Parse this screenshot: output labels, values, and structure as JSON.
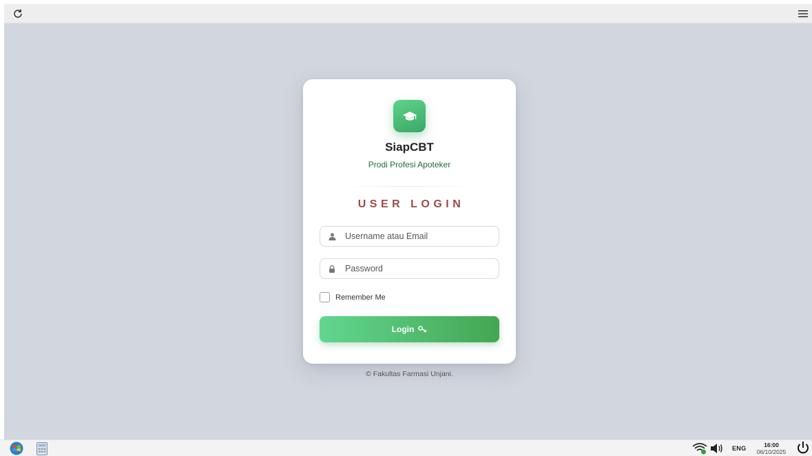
{
  "topbar": {
    "refresh_icon": "refresh-icon",
    "menu_icon": "hamburger-menu-icon"
  },
  "login_card": {
    "logo_icon": "graduation-cap-icon",
    "app_name": "SiapCBT",
    "subtitle": "Prodi Profesi Apoteker",
    "heading": "USER LOGIN",
    "username_placeholder": "Username atau Email",
    "username_value": "",
    "password_placeholder": "Password",
    "password_value": "",
    "remember_label": "Remember Me",
    "remember_checked": false,
    "login_label": "Login",
    "login_icon": "key-icon"
  },
  "footer": {
    "copyright": "© Fakultas Farmasi Unjani."
  },
  "taskbar": {
    "start_icon": "start-orb-icon",
    "calculator_icon": "calculator-icon",
    "wifi_icon": "wifi-icon",
    "volume_icon": "volume-icon",
    "language": "ENG",
    "time": "16:00",
    "date": "06/10/2025",
    "power_icon": "power-icon"
  },
  "colors": {
    "desktop_bg": "#d2d6de",
    "accent_green": "#4caf6a",
    "subtitle_green": "#1f6b3a",
    "heading_red": "#9c4a4a"
  }
}
